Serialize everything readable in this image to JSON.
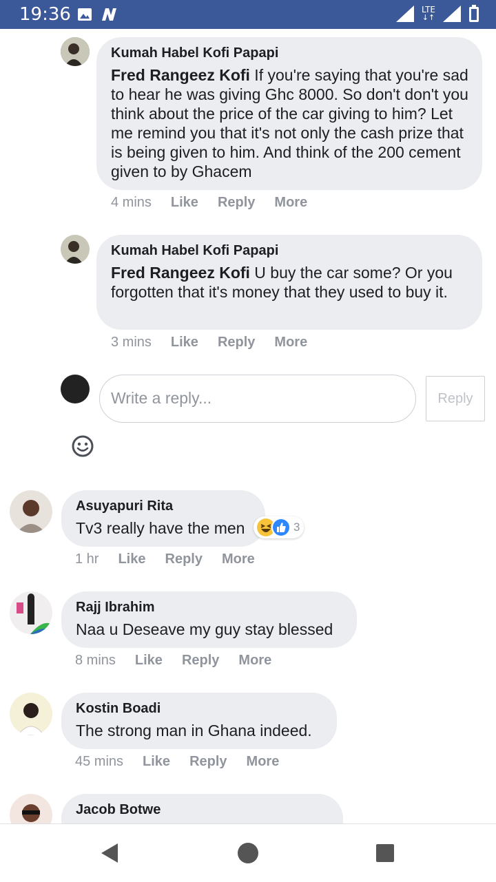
{
  "status_bar": {
    "time": "19:36",
    "network": "LTE"
  },
  "comments_nested": [
    {
      "author": "Kumah Habel Kofi Papapi",
      "mention": "Fred Rangeez Kofi",
      "text": " If you're saying that you're sad to hear he was giving Ghc 8000. So don't don't you think about the price of the car giving to him? Let me remind you that it's not only the cash prize that is being given to him. And think of the 200 cement given to by Ghacem",
      "time": "4 mins",
      "like": "Like",
      "reply": "Reply",
      "more": "More"
    },
    {
      "author": "Kumah Habel Kofi Papapi",
      "mention": "Fred Rangeez Kofi",
      "text": " U buy the car some? Or you forgotten that it's money that they used to buy it.",
      "time": "3 mins",
      "like": "Like",
      "reply": "Reply",
      "more": "More"
    }
  ],
  "reply_box": {
    "placeholder": "Write a reply...",
    "button": "Reply"
  },
  "comments": [
    {
      "author": "Asuyapuri Rita",
      "text": "Tv3 really have the men",
      "time": "1 hr",
      "like": "Like",
      "reply": "Reply",
      "more": "More",
      "reaction_count": "3"
    },
    {
      "author": "Rajj Ibrahim",
      "text": "Naa u Deseave my guy stay blessed",
      "time": "8 mins",
      "like": "Like",
      "reply": "Reply",
      "more": "More"
    },
    {
      "author": "Kostin Boadi",
      "text": "The strong man in Ghana indeed.",
      "time": "45 mins",
      "like": "Like",
      "reply": "Reply",
      "more": "More"
    },
    {
      "author": "Jacob Botwe"
    }
  ],
  "colors": {
    "status_bar": "#3b5998",
    "bubble": "#ebedf0",
    "meta": "#90949c"
  },
  "icons": [
    "image-icon",
    "n-icon",
    "signal-icon",
    "battery-icon",
    "emoji-icon",
    "haha-reaction-icon",
    "like-reaction-icon",
    "back-icon",
    "home-icon",
    "recents-icon"
  ]
}
